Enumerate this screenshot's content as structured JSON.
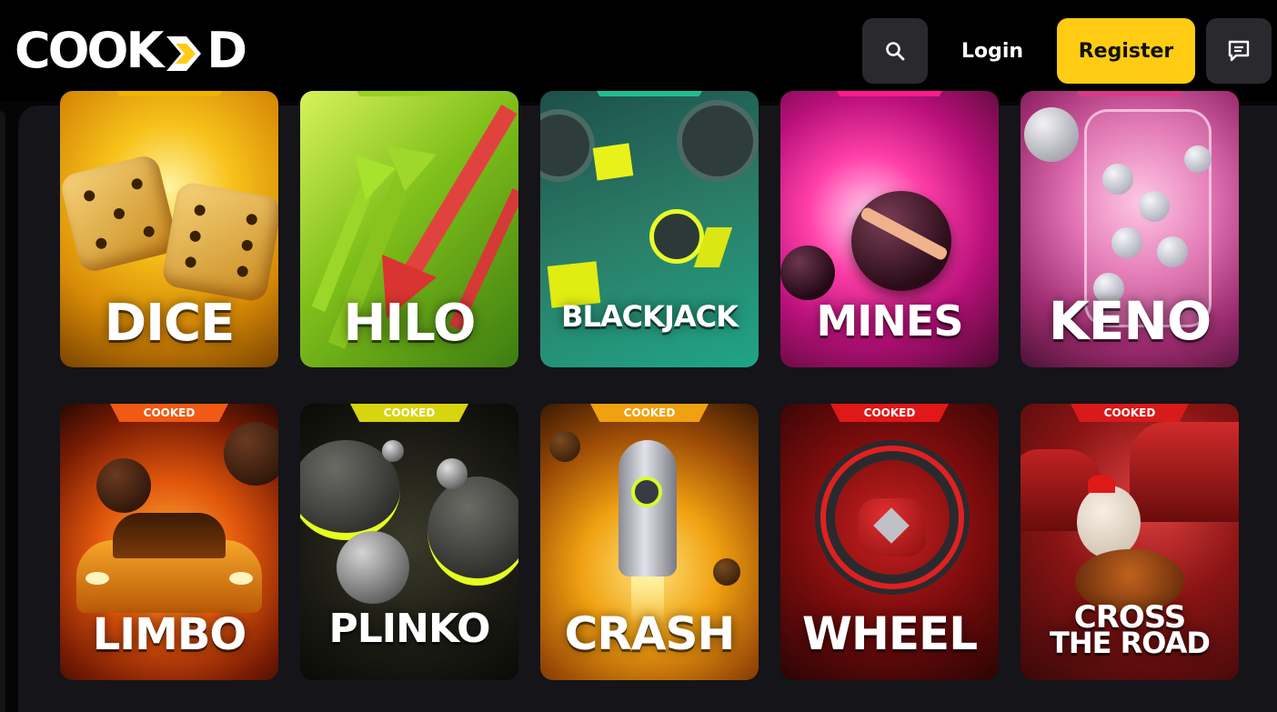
{
  "brand": {
    "logo_prefix": "COOK",
    "logo_suffix": "D",
    "accent": "#ffcc13"
  },
  "header": {
    "search_icon": "search-icon",
    "login_label": "Login",
    "register_label": "Register",
    "chat_icon": "chat-icon"
  },
  "games": [
    {
      "title": "DICE",
      "tag": "",
      "tag_color": "#f0b400"
    },
    {
      "title": "HILO",
      "tag": "",
      "tag_color": "#9ad11f"
    },
    {
      "title": "BLACKJACK",
      "tag": "",
      "tag_color": "#1fbf8f"
    },
    {
      "title": "MINES",
      "tag": "",
      "tag_color": "#ff1a8c"
    },
    {
      "title": "KENO",
      "tag": "",
      "tag_color": "#d93a8a"
    },
    {
      "title": "LIMBO",
      "tag": "COOKED",
      "tag_color": "#f05a14"
    },
    {
      "title": "PLINKO",
      "tag": "COOKED",
      "tag_color": "#d7d410"
    },
    {
      "title": "CRASH",
      "tag": "COOKED",
      "tag_color": "#f0a010"
    },
    {
      "title": "WHEEL",
      "tag": "COOKED",
      "tag_color": "#e01818"
    },
    {
      "title_line1": "CROSS",
      "title_line2": "THE ROAD",
      "tag": "COOKED",
      "tag_color": "#d91a1a"
    }
  ]
}
